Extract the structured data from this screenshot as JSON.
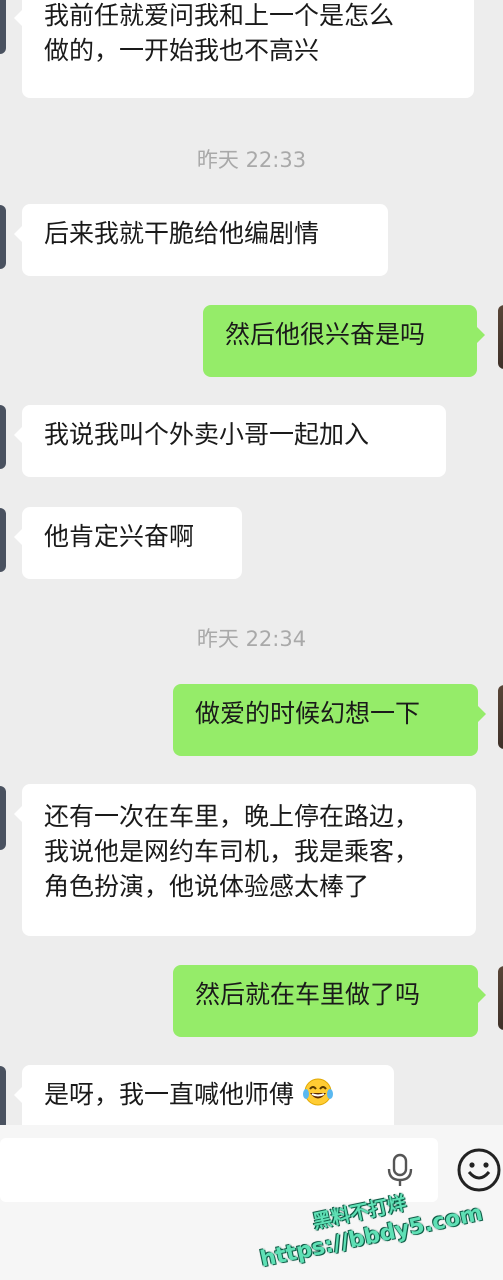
{
  "messages": [
    {
      "side": "left",
      "lines": [
        "我前任就爱问我和上一个是怎么",
        "做的，一开始我也不高兴"
      ]
    },
    {
      "side": "left",
      "lines": [
        "后来我就干脆给他编剧情"
      ]
    },
    {
      "side": "right",
      "lines": [
        "然后他很兴奋是吗"
      ]
    },
    {
      "side": "left",
      "lines": [
        "我说我叫个外卖小哥一起加入"
      ]
    },
    {
      "side": "left",
      "lines": [
        "他肯定兴奋啊"
      ]
    },
    {
      "side": "right",
      "lines": [
        "做爱的时候幻想一下"
      ]
    },
    {
      "side": "left",
      "lines": [
        "还有一次在车里，晚上停在路边，",
        "我说他是网约车司机，我是乘客，",
        "角色扮演，他说体验感太棒了"
      ]
    },
    {
      "side": "right",
      "lines": [
        "然后就在车里做了吗"
      ]
    },
    {
      "side": "left",
      "lines": [
        "是呀，我一直喊他师傅"
      ],
      "emoji": "laughing-tears-emoji"
    }
  ],
  "timestamps": [
    "昨天 22:33",
    "昨天 22:34"
  ],
  "input_bar": {
    "mic_icon": "microphone-icon",
    "emoji_icon": "smile-icon"
  },
  "watermark": {
    "line1": "黑料不打烊",
    "line2": "https://bbdy5.com"
  },
  "colors": {
    "background": "#ededed",
    "bubble_left": "#ffffff",
    "bubble_right": "#95ec69",
    "timestamp": "#a9a9a9",
    "watermark": "#5fe0b5"
  }
}
